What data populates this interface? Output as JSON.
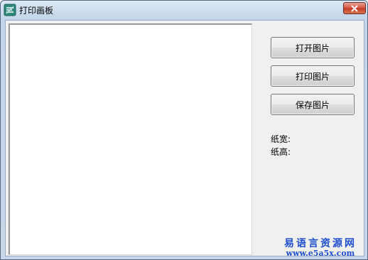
{
  "window": {
    "title": "打印画板",
    "icon": "app-icon",
    "close_icon": "close-icon"
  },
  "buttons": {
    "open_label": "打开图片",
    "print_label": "打印图片",
    "save_label": "保存图片"
  },
  "labels": {
    "paper_width": "纸宽:",
    "paper_height": "纸高:"
  },
  "watermark": {
    "name": "易语言资源网",
    "url": "www.e5a5x.com"
  },
  "colors": {
    "accent": "#1e4fd0",
    "close": "#c23a25"
  }
}
